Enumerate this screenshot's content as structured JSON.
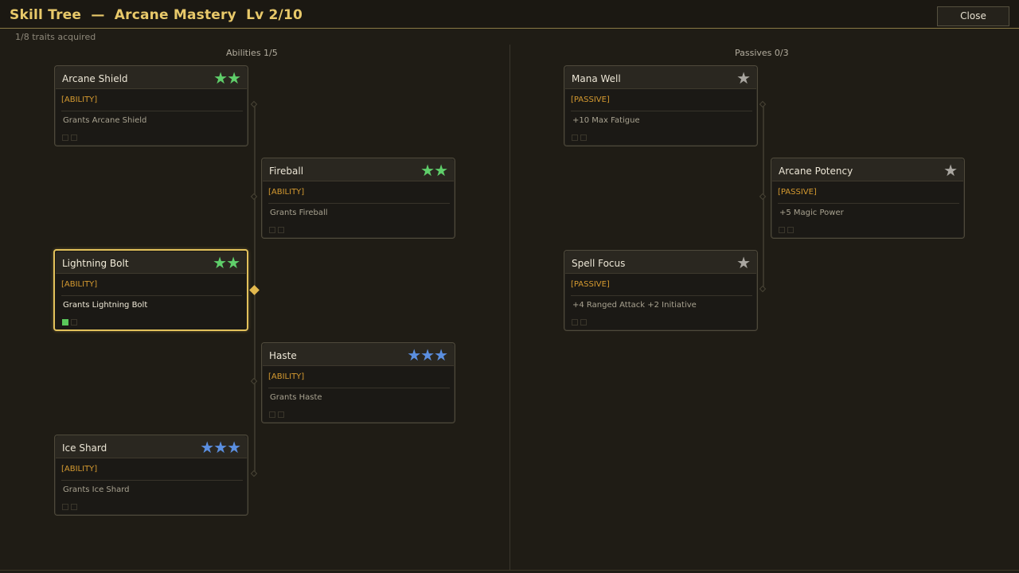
{
  "window": {
    "title": "Skill Tree  —  Arcane Mastery  Lv 2/10",
    "close_label": "Close",
    "subtitle": "1/8 traits acquired"
  },
  "columns": {
    "abilities_header": "Abilities  1/5",
    "passives_header": "Passives  0/3"
  },
  "colors": {
    "accent": "#e8c96a",
    "selected_border": "#e2c15b",
    "tag": "#d59a30",
    "star_green": "#5fce6a",
    "star_blue": "#5b8fe0",
    "star_grey": "#a9a6a0"
  },
  "cards": [
    {
      "name": "Arcane Shield",
      "tag": "[ABILITY]",
      "desc": "Grants Arcane Shield",
      "stars": "★★",
      "star_color": "#5fce6a",
      "pips": [
        false,
        false
      ],
      "selected": false
    },
    {
      "name": "Fireball",
      "tag": "[ABILITY]",
      "desc": "Grants Fireball",
      "stars": "★★",
      "star_color": "#5fce6a",
      "pips": [
        false,
        false
      ],
      "selected": false
    },
    {
      "name": "Lightning Bolt",
      "tag": "[ABILITY]",
      "desc": "Grants Lightning Bolt",
      "stars": "★★",
      "star_color": "#5fce6a",
      "pips": [
        true,
        false
      ],
      "selected": true
    },
    {
      "name": "Haste",
      "tag": "[ABILITY]",
      "desc": "Grants Haste",
      "stars": "★★★",
      "star_color": "#5b8fe0",
      "pips": [
        false,
        false
      ],
      "selected": false
    },
    {
      "name": "Ice Shard",
      "tag": "[ABILITY]",
      "desc": "Grants Ice Shard",
      "stars": "★★★",
      "star_color": "#5b8fe0",
      "pips": [
        false,
        false
      ],
      "selected": false
    },
    {
      "name": "Mana Well",
      "tag": "[PASSIVE]",
      "desc": "+10 Max Fatigue",
      "stars": "★",
      "star_color": "#a9a6a0",
      "pips": [
        false,
        false
      ],
      "selected": false
    },
    {
      "name": "Arcane Potency",
      "tag": "[PASSIVE]",
      "desc": "+5 Magic Power",
      "stars": "★",
      "star_color": "#a9a6a0",
      "pips": [
        false,
        false
      ],
      "selected": false
    },
    {
      "name": "Spell Focus",
      "tag": "[PASSIVE]",
      "desc": "+4 Ranged Attack +2 Initiative",
      "stars": "★",
      "star_color": "#a9a6a0",
      "pips": [
        false,
        false
      ],
      "selected": false
    }
  ]
}
